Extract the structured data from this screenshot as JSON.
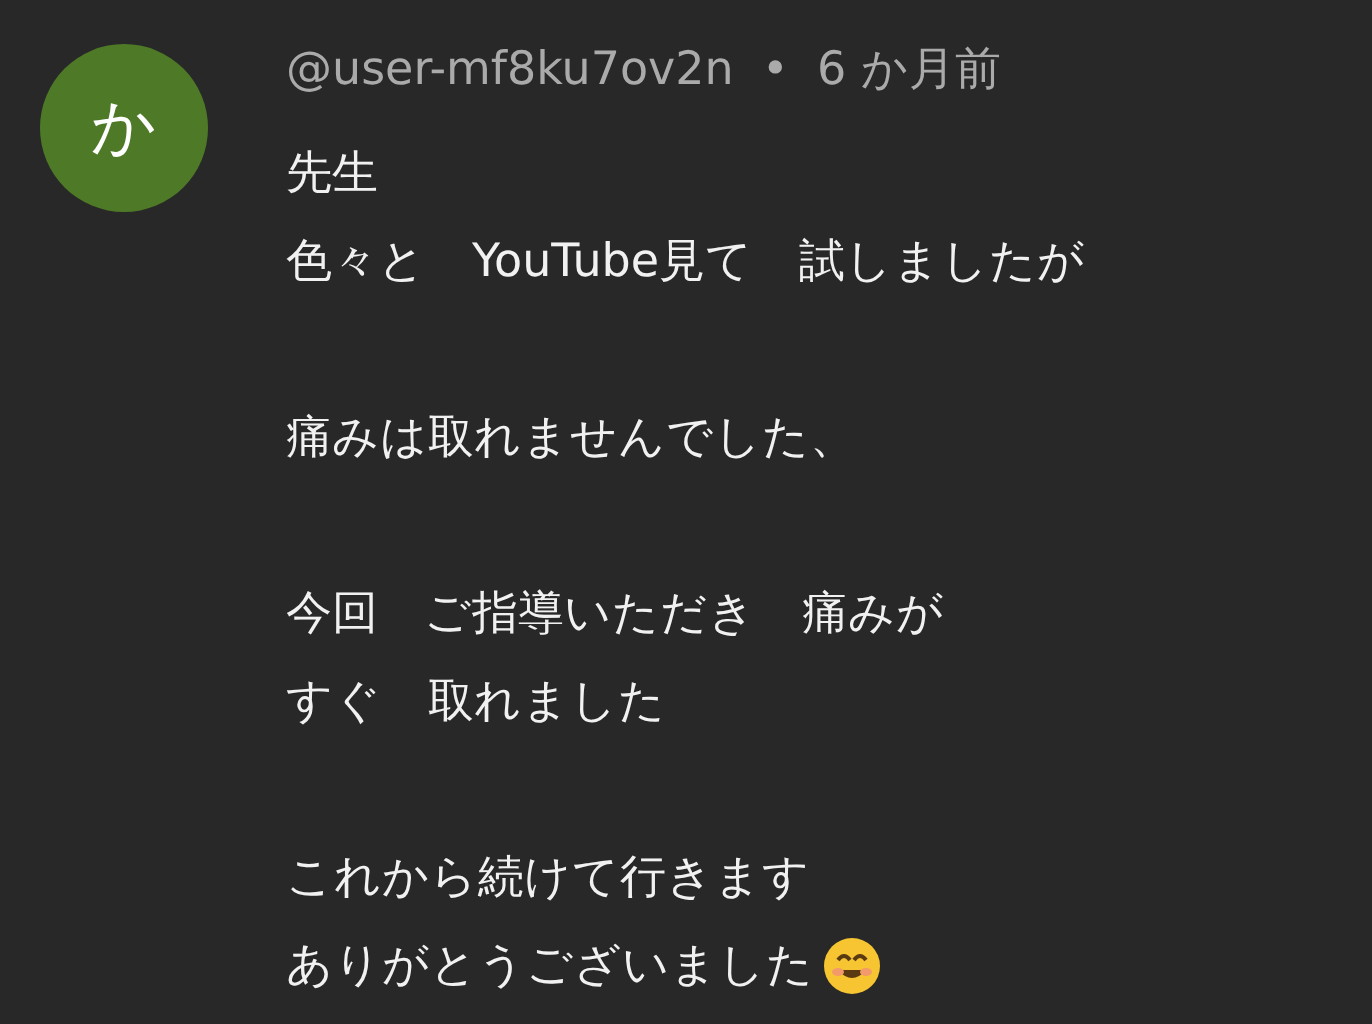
{
  "comment": {
    "avatar_letter": "か",
    "author": "@user-mf8ku7ov2n",
    "separator": "•",
    "time": "6 か月前",
    "paragraphs": [
      [
        "先生",
        "色々と　YouTube見て　試しましたが"
      ],
      [
        "痛みは取れませんでした、"
      ],
      [
        "今回　ご指導いただき　痛みが",
        "すぐ　取れました"
      ],
      [
        "これから続けて行きます",
        "ありがとうございました"
      ]
    ]
  }
}
